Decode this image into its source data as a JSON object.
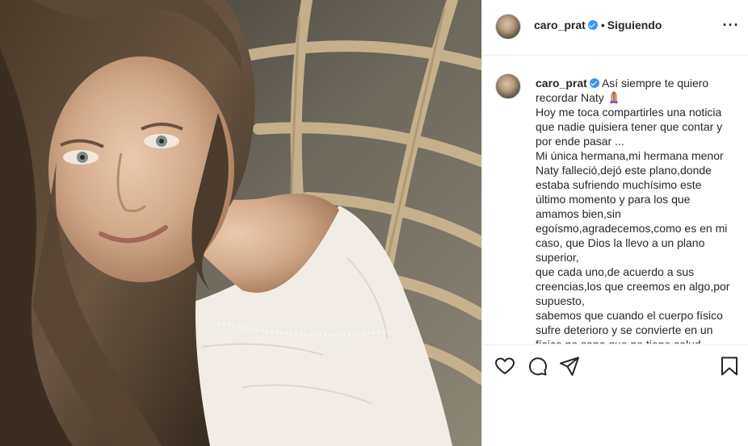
{
  "post": {
    "username": "caro_prat",
    "follow_separator": "•",
    "follow_status": "Siguiendo",
    "more_icon": "more-options-icon",
    "caption_lines": [
      "Así siempre te quiero",
      "recordar Naty",
      "Hoy me toca compartirles una noticia",
      "que nadie quisiera tener que contar y",
      "por ende pasar ...",
      "Mi única hermana,mi hermana menor",
      "Naty falleció,dejó este plano,donde",
      "estaba sufriendo muchísimo este",
      "último momento y para los que",
      "amamos bien,sin",
      "egoísmo,agradecemos,como es en mi",
      "caso, que Dios la llevo a un plano",
      "superior,",
      "que cada uno,de acuerdo a sus",
      "creencias,los que creemos en algo,por",
      "supuesto,",
      "sabemos que cuando el cuerpo físico",
      "sufre deterioro y se convierte en un",
      "físico no sano que no tiene salud"
    ],
    "emoji": "praying-hands-emoji"
  },
  "icons": {
    "like": "heart-icon",
    "comment": "comment-icon",
    "share": "share-icon",
    "save": "bookmark-icon"
  },
  "colors": {
    "verified": "#3897f0",
    "text": "#262626",
    "border": "#efefef"
  }
}
